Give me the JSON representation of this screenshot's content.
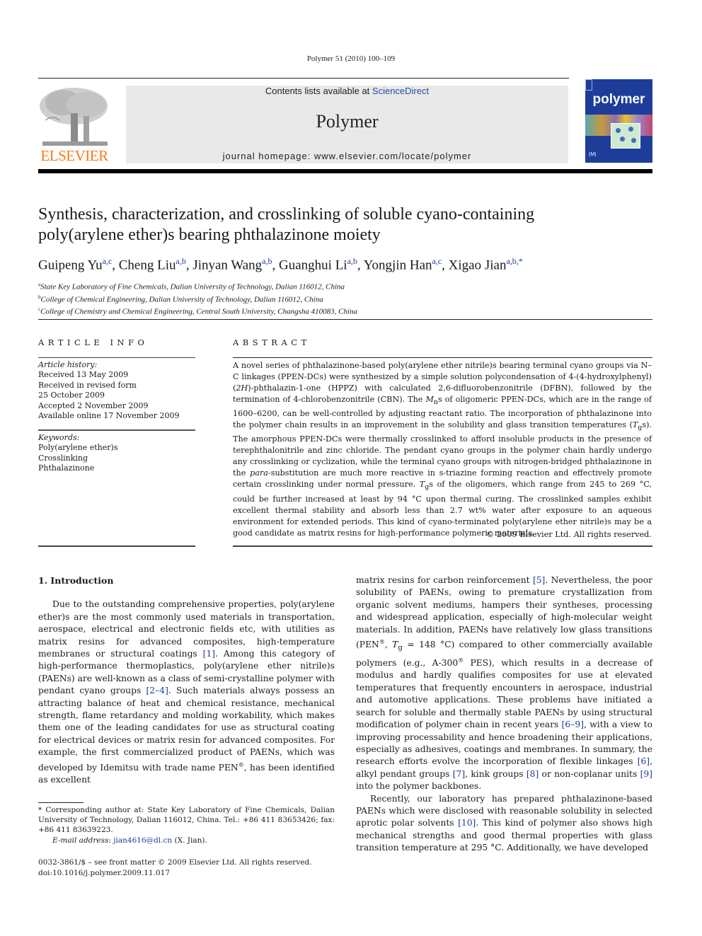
{
  "running_head": "Polymer 51 (2010) 100–109",
  "masthead": {
    "publisher_logo_text": "ELSEVIER",
    "contents_prefix": "Contents lists available at ",
    "contents_link": "ScienceDirect",
    "journal_name": "Polymer",
    "homepage": "journal homepage: www.elsevier.com/locate/polymer",
    "cover_title": "polymer",
    "brand_color": "#f07c1b",
    "link_color": "#1f4ea1",
    "cover_color": "#1e3d9a"
  },
  "article": {
    "title_line1": "Synthesis, characterization, and crosslinking of soluble cyano-containing",
    "title_line2": "poly(arylene ether)s bearing phthalazinone moiety",
    "authors": [
      {
        "name": "Guipeng Yu",
        "sup": "a,c"
      },
      {
        "name": "Cheng Liu",
        "sup": "a,b"
      },
      {
        "name": "Jinyan Wang",
        "sup": "a,b"
      },
      {
        "name": "Guanghui Li",
        "sup": "a,b"
      },
      {
        "name": "Yongjin Han",
        "sup": "a,c"
      },
      {
        "name": "Xigao Jian",
        "sup": "a,b,*"
      }
    ],
    "affiliations": [
      {
        "key": "a",
        "text": "State Key Laboratory of Fine Chemicals, Dalian University of Technology, Dalian 116012, China"
      },
      {
        "key": "b",
        "text": "College of Chemical Engineering, Dalian University of Technology, Dalian 116012, China"
      },
      {
        "key": "c",
        "text": "College of Chemistry and Chemical Engineering, Central South University, Changsha 410083, China"
      }
    ]
  },
  "article_info": {
    "heading": "ARTICLE INFO",
    "history_label": "Article history:",
    "history": [
      "Received 13 May 2009",
      "Received in revised form",
      "25 October 2009",
      "Accepted 2 November 2009",
      "Available online 17 November 2009"
    ],
    "keywords_label": "Keywords:",
    "keywords": [
      "Poly(arylene ether)s",
      "Crosslinking",
      "Phthalazinone"
    ]
  },
  "abstract": {
    "heading": "ABSTRACT",
    "p1": "A novel series of phthalazinone-based poly(arylene ether nitrile)s bearing terminal cyano groups via N–C linkages (PPEN-DCs) were synthesized by a simple solution polycondensation of 4-(4-hydroxylphenyl)(",
    "p1_2h": "2H",
    "p2": ")-phthalazin-1-one (HPPZ) with calculated 2,6-difluorobenzonitrile (DFBN), followed by the termination of 4-chlorobenzonitrile (CBN). The ",
    "mn_m": "M",
    "mn_sub": "n",
    "p3": "s of oligomeric PPEN-DCs, which are in the range of 1600–6200, can be well-controlled by adjusting reactant ratio. The incorporation of phthalazinone into the polymer chain results in an improvement in the solubility and glass transition temperatures (",
    "tg_t": "T",
    "tg_sub": "g",
    "p4": "s). The amorphous PPEN-DCs were thermally crosslinked to afford insoluble products in the presence of terephthalonitrile and zinc chloride. The pendant cyano groups in the polymer chain hardly undergo any crosslinking or cyclization, while the terminal cyano groups with nitrogen-bridged phthalazinone in the ",
    "para": "para",
    "p5": "-substitution are much more reactive in s-triazine forming reaction and effectively promote certain crosslinking under normal pressure. ",
    "p6": "s of the oligomers, which range from 245 to 269 °C, could be further increased at least by 94 °C upon thermal curing. The crosslinked samples exhibit excellent thermal stability and absorb less than 2.7 wt% water after exposure to an aqueous environment for extended periods. This kind of cyano-terminated poly(arylene ether nitrile)s may be a good candidate as matrix resins for high-performance polymeric materials.",
    "copyright": "© 2009 Elsevier Ltd. All rights reserved."
  },
  "introduction": {
    "heading": "1.  Introduction",
    "left_p1_a": "Due to the outstanding comprehensive properties, poly(arylene ether)s are the most commonly used materials in transportation, aerospace, electrical and electronic fields etc, with utilities as matrix resins for advanced composites, high-temperature membranes or structural coatings ",
    "ref1": "[1]",
    "left_p1_b": ". Among this category of high-performance thermoplastics, poly(arylene ether nitrile)s (PAENs) are well-known as a class of semi-crystalline polymer with pendant cyano groups ",
    "ref2_4": "[2–4]",
    "left_p1_c": ". Such materials always possess an attracting balance of heat and chemical resistance, mechanical strength, flame retardancy and molding workability, which makes them one of the leading candidates for use as structural coating for electrical devices or matrix resin for advanced composites. For example, the first commercialized product of PAENs, which was developed by Idemitsu with trade name PEN",
    "reg": "®",
    "left_p1_d": ", has been identified as excellent",
    "right_p1_a": "matrix resins for carbon reinforcement ",
    "ref5": "[5]",
    "right_p1_b": ". Nevertheless, the poor solubility of PAENs, owing to premature crystallization from organic solvent mediums, hampers their syntheses, processing and widespread application, especially of high-molecular weight materials. In addition, PAENs have relatively low glass transitions (PEN",
    "right_p1_c": ", ",
    "right_tg_eq": " = 148 °C) compared to other commercially available polymers (e.g., A-300",
    "right_p1_d": " PES), which results in a decrease of modulus and hardly qualifies composites for use at elevated temperatures that frequently encounters in aerospace, industrial and automotive applications. These problems have initiated a search for soluble and thermally stable PAENs by using structural modification of polymer chain in recent years ",
    "ref6_9": "[6–9]",
    "right_p1_e": ", with a view to improving processability and hence broadening their applications, especially as adhesives, coatings and membranes. In summary, the research efforts evolve the incorporation of flexible linkages ",
    "ref6": "[6]",
    "right_p1_f": ", alkyl pendant groups ",
    "ref7": "[7]",
    "right_p1_g": ", kink groups ",
    "ref8": "[8]",
    "right_p1_h": " or non-coplanar units ",
    "ref9": "[9]",
    "right_p1_i": " into the polymer backbones.",
    "right_p2_a": "Recently, our laboratory has prepared phthalazinone-based PAENs which were disclosed with reasonable solubility in selected aprotic polar solvents ",
    "ref10": "[10]",
    "right_p2_b": ". This kind of polymer also shows high mechanical strengths and good thermal properties with glass transition temperature at 295 °C. Additionally, we have developed"
  },
  "footnote": {
    "corresponding": "* Corresponding author at: State Key Laboratory of Fine Chemicals, Dalian University of Technology, Dalian 116012, China. Tel.: +86 411 83653426; fax: +86 411 83639223.",
    "email_label": "E-mail address:",
    "email": "jian4616@dl.cn",
    "email_suffix": " (X. Jian)."
  },
  "front_matter": {
    "issn_line": "0032-3861/$ – see front matter © 2009 Elsevier Ltd. All rights reserved.",
    "doi": "doi:10.1016/j.polymer.2009.11.017"
  }
}
